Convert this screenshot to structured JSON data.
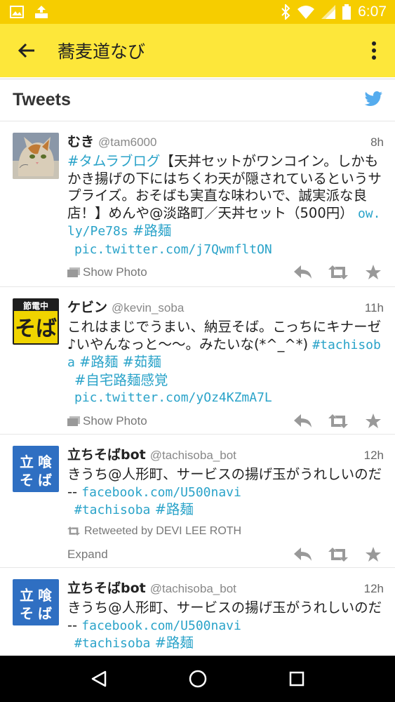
{
  "status_bar": {
    "time": "6:07",
    "left_icons": [
      "image-icon",
      "data-saver-icon"
    ],
    "right_icons": [
      "bluetooth-icon",
      "wifi-icon",
      "signal-icon",
      "battery-icon"
    ]
  },
  "app_bar": {
    "title": "蕎麦道なび",
    "back_icon": "arrow-back-icon",
    "menu_icon": "overflow-menu-icon"
  },
  "card": {
    "title": "Tweets",
    "logo": "twitter-bird-icon"
  },
  "tweets": [
    {
      "name": "むき",
      "handle": "@tam6000",
      "time": "8h",
      "text_tag": "#タムラブログ",
      "text_main": "【天丼セットがワンコイン。しかもかき揚げの下にはちくわ天が隠されているというサプライズ。おそばも実直な味わいで、誠実派な良店！】めんや@淡路町／天丼セット（500円）",
      "link1": "ow.ly/Pe78s",
      "tag1": "#路麺",
      "link2": "pic.twitter.com/j7QwmfltON",
      "action_label": "Show Photo"
    },
    {
      "name": "ケビン",
      "handle": "@kevin_soba",
      "time": "11h",
      "text_main": "これはまじでうまい、納豆そば。こっちにキナーゼ♪いやんなっと〜〜。みたいな(*^_^*)",
      "tags": [
        "#tachisoba",
        "#路麺",
        "#茹麺"
      ],
      "tag_line2": "#自宅路麺感覚",
      "link": "pic.twitter.com/yOz4KZmA7L",
      "action_label": "Show Photo"
    },
    {
      "name": "立ちそばbot",
      "handle": "@tachisoba_bot",
      "time": "12h",
      "text_main": "きうち@人形町、サービスの揚げ玉がうれしいのだ --",
      "link": "facebook.com/U500navi",
      "tags": [
        "#tachisoba",
        "#路麺"
      ],
      "retweeted_by": "Retweeted by DEVI LEE ROTH",
      "action_label": "Expand"
    },
    {
      "name": "立ちそばbot",
      "handle": "@tachisoba_bot",
      "time": "12h",
      "text_main": "きうち@人形町、サービスの揚げ玉がうれしいのだ --",
      "link": "facebook.com/U500navi",
      "tags": [
        "#tachisoba",
        "#路麺"
      ]
    }
  ],
  "avatar_texts": {
    "kevin_top": "節電中",
    "kevin_bottom": "そば",
    "bot_chars": [
      "立",
      "喰",
      "そ",
      "ば"
    ]
  },
  "colors": {
    "status_bar": "#f6cd00",
    "app_bar": "#fde73a",
    "link": "#2aa3c9",
    "twitter_blue": "#55acee",
    "bot_avatar": "#2f6fc2"
  },
  "nav_bar": [
    "back-triangle-icon",
    "home-circle-icon",
    "recents-square-icon"
  ]
}
